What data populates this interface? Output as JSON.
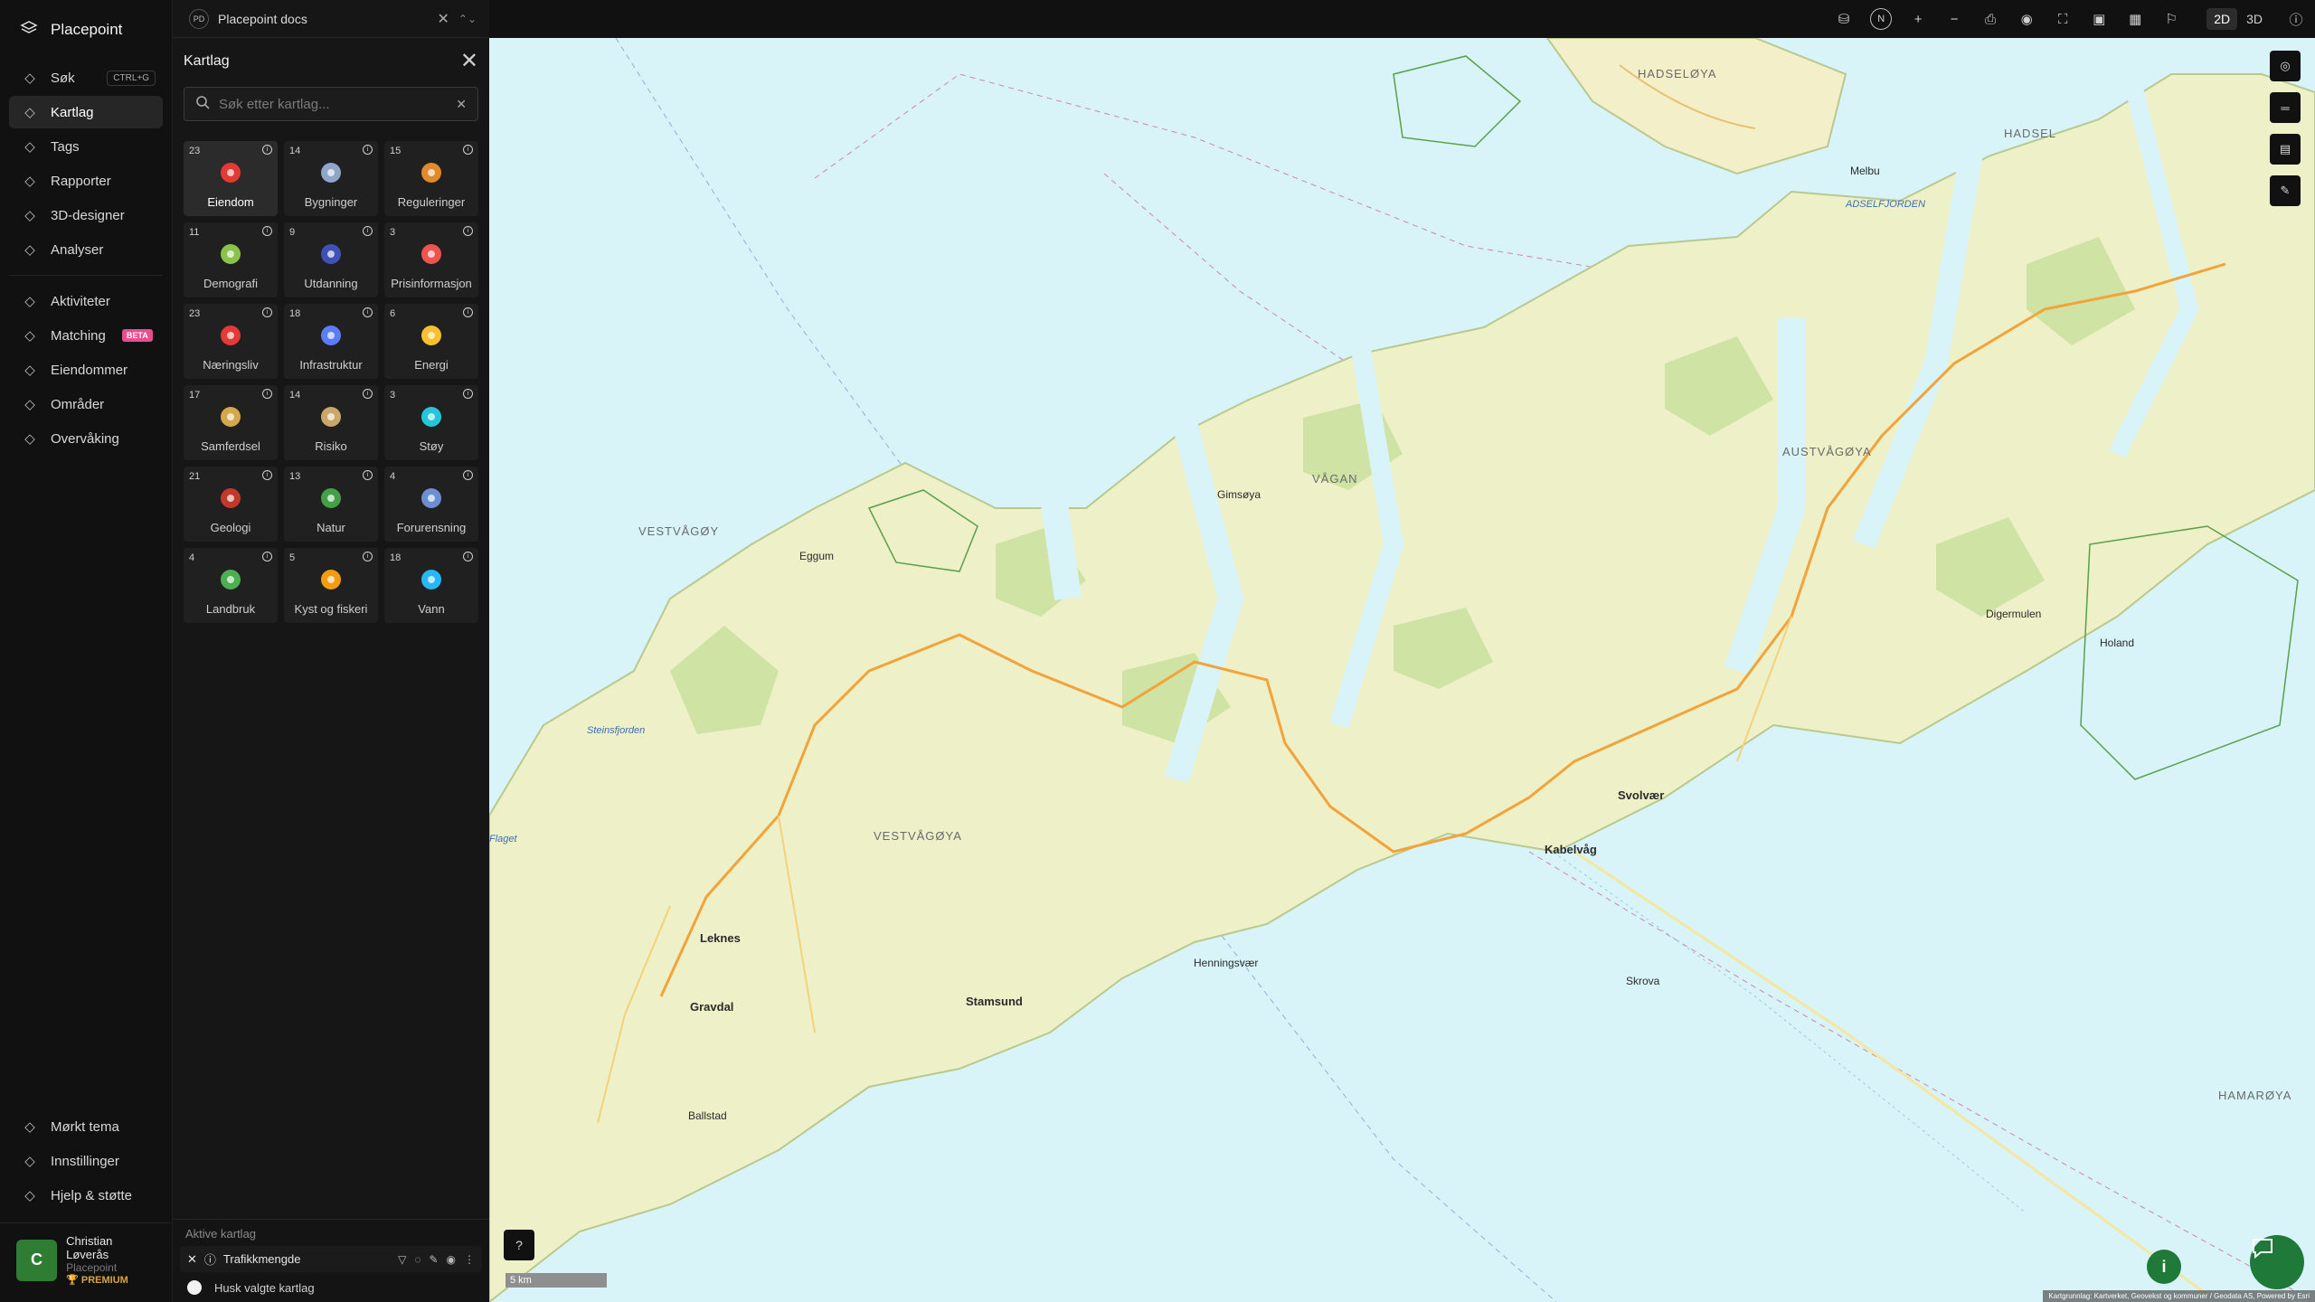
{
  "app": {
    "name": "Placepoint"
  },
  "nav": {
    "items": [
      {
        "label": "Søk",
        "icon": "search-icon",
        "shortcut": "CTRL+G"
      },
      {
        "label": "Kartlag",
        "icon": "layers-icon",
        "active": true
      },
      {
        "label": "Tags",
        "icon": "bookmark-icon"
      },
      {
        "label": "Rapporter",
        "icon": "bar-chart-icon"
      },
      {
        "label": "3D-designer",
        "icon": "cube-icon"
      },
      {
        "label": "Analyser",
        "icon": "bolt-icon"
      }
    ],
    "items2": [
      {
        "label": "Aktiviteter",
        "icon": "activity-icon"
      },
      {
        "label": "Matching",
        "icon": "matching-icon",
        "badge": "BETA"
      },
      {
        "label": "Eiendommer",
        "icon": "building-icon"
      },
      {
        "label": "Områder",
        "icon": "area-icon"
      },
      {
        "label": "Overvåking",
        "icon": "monitor-icon"
      }
    ],
    "bottom": [
      {
        "label": "Mørkt tema",
        "icon": "moon-icon"
      },
      {
        "label": "Innstillinger",
        "icon": "settings-icon"
      },
      {
        "label": "Hjelp & støtte",
        "icon": "help-icon"
      }
    ],
    "user": {
      "initial": "C",
      "name": "Christian Løverås",
      "org": "Placepoint",
      "plan": "PREMIUM"
    }
  },
  "topbar": {
    "badge": "PD",
    "workspace": "Placepoint docs"
  },
  "panel": {
    "title": "Kartlag",
    "search_placeholder": "Søk etter kartlag...",
    "categories": [
      {
        "count": "23",
        "label": "Eiendom",
        "icon": "pin-icon",
        "color": "#e53935",
        "active": true
      },
      {
        "count": "14",
        "label": "Bygninger",
        "icon": "buildings-icon",
        "color": "#8fa6c9"
      },
      {
        "count": "15",
        "label": "Reguleringer",
        "icon": "signpost-icon",
        "color": "#e08a2c"
      },
      {
        "count": "11",
        "label": "Demografi",
        "icon": "demography-icon",
        "color": "#8bc34a"
      },
      {
        "count": "9",
        "label": "Utdanning",
        "icon": "graduation-icon",
        "color": "#3f51b5"
      },
      {
        "count": "3",
        "label": "Prisinformasjon",
        "icon": "price-icon",
        "color": "#ef5350"
      },
      {
        "count": "23",
        "label": "Næringsliv",
        "icon": "shopping-bag-icon",
        "color": "#e53935"
      },
      {
        "count": "18",
        "label": "Infrastruktur",
        "icon": "globe-icon",
        "color": "#5c7cfa"
      },
      {
        "count": "6",
        "label": "Energi",
        "icon": "lightning-icon",
        "color": "#fbc02d"
      },
      {
        "count": "17",
        "label": "Samferdsel",
        "icon": "bus-icon",
        "color": "#d4a84a"
      },
      {
        "count": "14",
        "label": "Risiko",
        "icon": "risk-icon",
        "color": "#c9a86a"
      },
      {
        "count": "3",
        "label": "Støy",
        "icon": "noise-icon",
        "color": "#26c6da"
      },
      {
        "count": "21",
        "label": "Geologi",
        "icon": "geology-icon",
        "color": "#c0392b"
      },
      {
        "count": "13",
        "label": "Natur",
        "icon": "leaf-icon",
        "color": "#43a047"
      },
      {
        "count": "4",
        "label": "Forurensning",
        "icon": "factory-icon",
        "color": "#6b8fd1"
      },
      {
        "count": "4",
        "label": "Landbruk",
        "icon": "sprout-icon",
        "color": "#4caf50"
      },
      {
        "count": "5",
        "label": "Kyst og fiskeri",
        "icon": "fish-icon",
        "color": "#f39c12"
      },
      {
        "count": "18",
        "label": "Vann",
        "icon": "water-drop-icon",
        "color": "#29b6f6"
      }
    ],
    "active_title": "Aktive kartlag",
    "active_layer": "Trafikkmengde",
    "remember_label": "Husk valgte kartlag"
  },
  "toolbar": {
    "north": "N",
    "mode_2d": "2D",
    "mode_3d": "3D"
  },
  "map": {
    "labels": [
      {
        "text": "HADSELØYA",
        "kind": "region"
      },
      {
        "text": "HADSEL",
        "kind": "region"
      },
      {
        "text": "ADSELFJORDEN",
        "kind": "water"
      },
      {
        "text": "Melbu",
        "kind": "place"
      },
      {
        "text": "VESTVÅGØY",
        "kind": "region"
      },
      {
        "text": "VÅGAN",
        "kind": "region"
      },
      {
        "text": "AUSTVÅGØYA",
        "kind": "region"
      },
      {
        "text": "VESTVÅGØYA",
        "kind": "region"
      },
      {
        "text": "Gimsøya",
        "kind": "place"
      },
      {
        "text": "Svolvær",
        "kind": "major"
      },
      {
        "text": "Kabelvåg",
        "kind": "major"
      },
      {
        "text": "Stamsund",
        "kind": "major"
      },
      {
        "text": "Leknes",
        "kind": "major"
      },
      {
        "text": "Gravdal",
        "kind": "major"
      },
      {
        "text": "Henningsvær",
        "kind": "place"
      },
      {
        "text": "Skrova",
        "kind": "place"
      },
      {
        "text": "Flaget",
        "kind": "water"
      },
      {
        "text": "Steinsfjorden",
        "kind": "water"
      },
      {
        "text": "Eggum",
        "kind": "place"
      },
      {
        "text": "Ballstad",
        "kind": "place"
      },
      {
        "text": "HAMARØYA",
        "kind": "region"
      },
      {
        "text": "Digermulen",
        "kind": "place"
      },
      {
        "text": "Holand",
        "kind": "place"
      }
    ],
    "scale": "5 km",
    "attribution": "Kartgrunnlag: Kartverket, Geovekst og kommuner / Geodata AS, Powered by Esri"
  }
}
